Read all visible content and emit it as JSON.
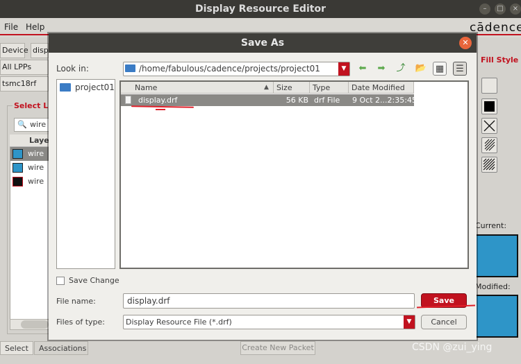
{
  "app": {
    "title": "Display Resource Editor",
    "logo": "cādence",
    "menu": [
      "File",
      "Help"
    ],
    "left_panel": {
      "device_label": "Device",
      "device_value": "disp",
      "lpp_filter": "All LPPs",
      "tech": "tsmc18rf",
      "select_lpp_title": "Select LP",
      "search_value": "wire",
      "table_header": "Laye",
      "rows": [
        {
          "name": "wire",
          "color": "#2e95c8"
        },
        {
          "name": "wire",
          "color": "#2e95c8"
        },
        {
          "name": "wire",
          "color": "#111111"
        }
      ]
    },
    "bottom_tabs": [
      "Select",
      "Associations"
    ],
    "create_packet": "Create New Packet",
    "right_panel": {
      "title": "Fill Style",
      "current_label": "Current:",
      "modified_label": "Modified:",
      "swatch_color": "#2e95c8"
    },
    "watermark": "CSDN @zui_ying",
    "accent_color": "#c1121f"
  },
  "dialog": {
    "title": "Save As",
    "look_in_label": "Look in:",
    "look_in_path": "/home/fabulous/cadence/projects/project01",
    "places": [
      "project01"
    ],
    "columns": [
      "Name",
      "Size",
      "Type",
      "Date Modified"
    ],
    "files": [
      {
        "name": "display.drf",
        "size": "56 KB",
        "type": "drf File",
        "date": "9 Oct 2...2:35:45"
      }
    ],
    "save_change_label": "Save Change",
    "file_name_label": "File name:",
    "file_name_value": "display.drf",
    "save_button": "Save",
    "files_of_type_label": "Files of type:",
    "files_of_type_value": "Display Resource File (*.drf)",
    "cancel_button": "Cancel"
  }
}
